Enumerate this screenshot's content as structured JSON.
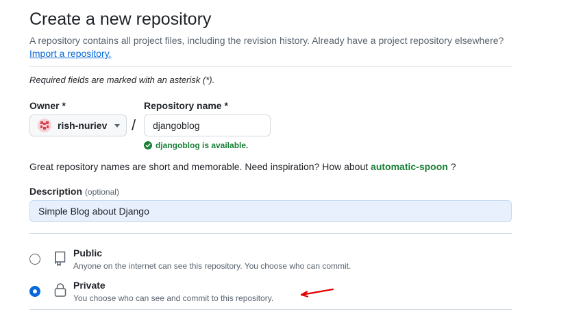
{
  "header": {
    "title": "Create a new repository",
    "subtitle": "A repository contains all project files, including the revision history. Already have a project repository elsewhere?",
    "import_link": "Import a repository."
  },
  "form": {
    "required_note": "Required fields are marked with an asterisk (*).",
    "owner": {
      "label": "Owner *",
      "selected": "rish-nuriev",
      "avatar_icon": "identicon-avatar"
    },
    "separator": "/",
    "repo_name": {
      "label": "Repository name *",
      "value": "djangoblog",
      "status_icon": "check-circle-icon",
      "status_text": "djangoblog is available."
    },
    "suggestion": {
      "prefix": "Great repository names are short and memorable. Need inspiration? How about",
      "name": "automatic-spoon",
      "suffix": "?"
    },
    "description": {
      "label": "Description",
      "optional": "(optional)",
      "value": "Simple Blog about Django"
    },
    "visibility": {
      "options": [
        {
          "title": "Public",
          "description": "Anyone on the internet can see this repository. You choose who can commit.",
          "icon": "repo-icon",
          "selected": false
        },
        {
          "title": "Private",
          "description": "You choose who can see and commit to this repository.",
          "icon": "lock-icon",
          "selected": true
        }
      ]
    }
  },
  "colors": {
    "link": "#0969da",
    "success": "#1a7f37",
    "annotation_arrow": "#e00000",
    "radio_selected": "#0969da"
  }
}
